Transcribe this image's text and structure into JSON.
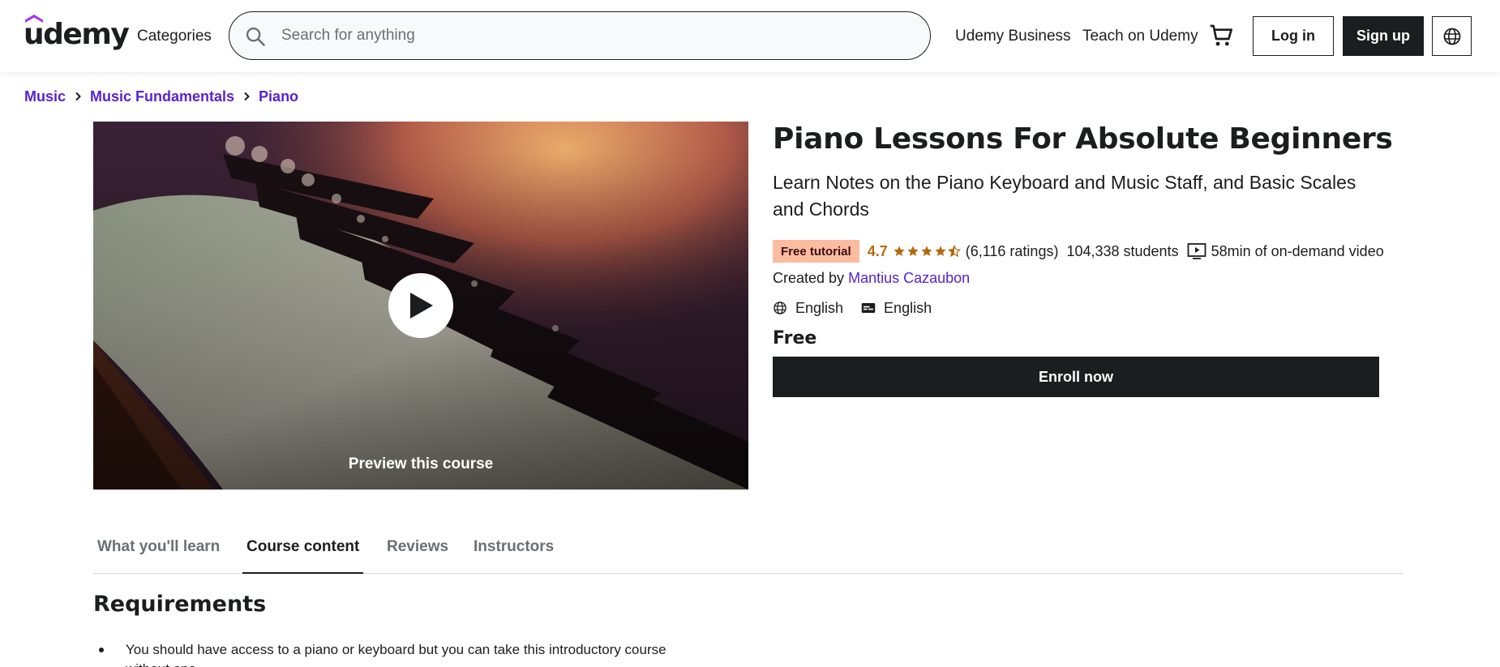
{
  "header": {
    "logo_text": "udemy",
    "categories_label": "Categories",
    "search_placeholder": "Search for anything",
    "udemy_business_label": "Udemy Business",
    "teach_label": "Teach on Udemy",
    "login_label": "Log in",
    "signup_label": "Sign up",
    "icons": [
      "search-icon",
      "cart-icon",
      "globe-icon"
    ]
  },
  "breadcrumb": [
    "Music",
    "Music Fundamentals",
    "Piano"
  ],
  "preview": {
    "label": "Preview this course"
  },
  "course": {
    "title": "Piano Lessons For Absolute Beginners",
    "subtitle": "Learn Notes on the Piano Keyboard and Music Staff, and Basic Scales and Chords",
    "badge": "Free tutorial",
    "rating": "4.7",
    "stars": 4.7,
    "ratings_count": "(6,116 ratings)",
    "students": "104,338 students",
    "video_length": "58min of on-demand video",
    "created_by_prefix": "Created by",
    "instructor": "Mantius Cazaubon",
    "language": "English",
    "captions": "English",
    "price": "Free",
    "enroll_label": "Enroll now"
  },
  "tabs": [
    {
      "label": "What you'll learn",
      "active": false
    },
    {
      "label": "Course content",
      "active": true
    },
    {
      "label": "Reviews",
      "active": false
    },
    {
      "label": "Instructors",
      "active": false
    }
  ],
  "requirements": {
    "title": "Requirements",
    "items": [
      "You should have access to a piano or keyboard but you can take this introductory course without one"
    ]
  },
  "colors": {
    "brand_purple": "#a435f0",
    "link_purple": "#5624d0",
    "rating_orange": "#b4690e",
    "badge_bg": "#fcbca0",
    "dark": "#1c1d1f"
  }
}
